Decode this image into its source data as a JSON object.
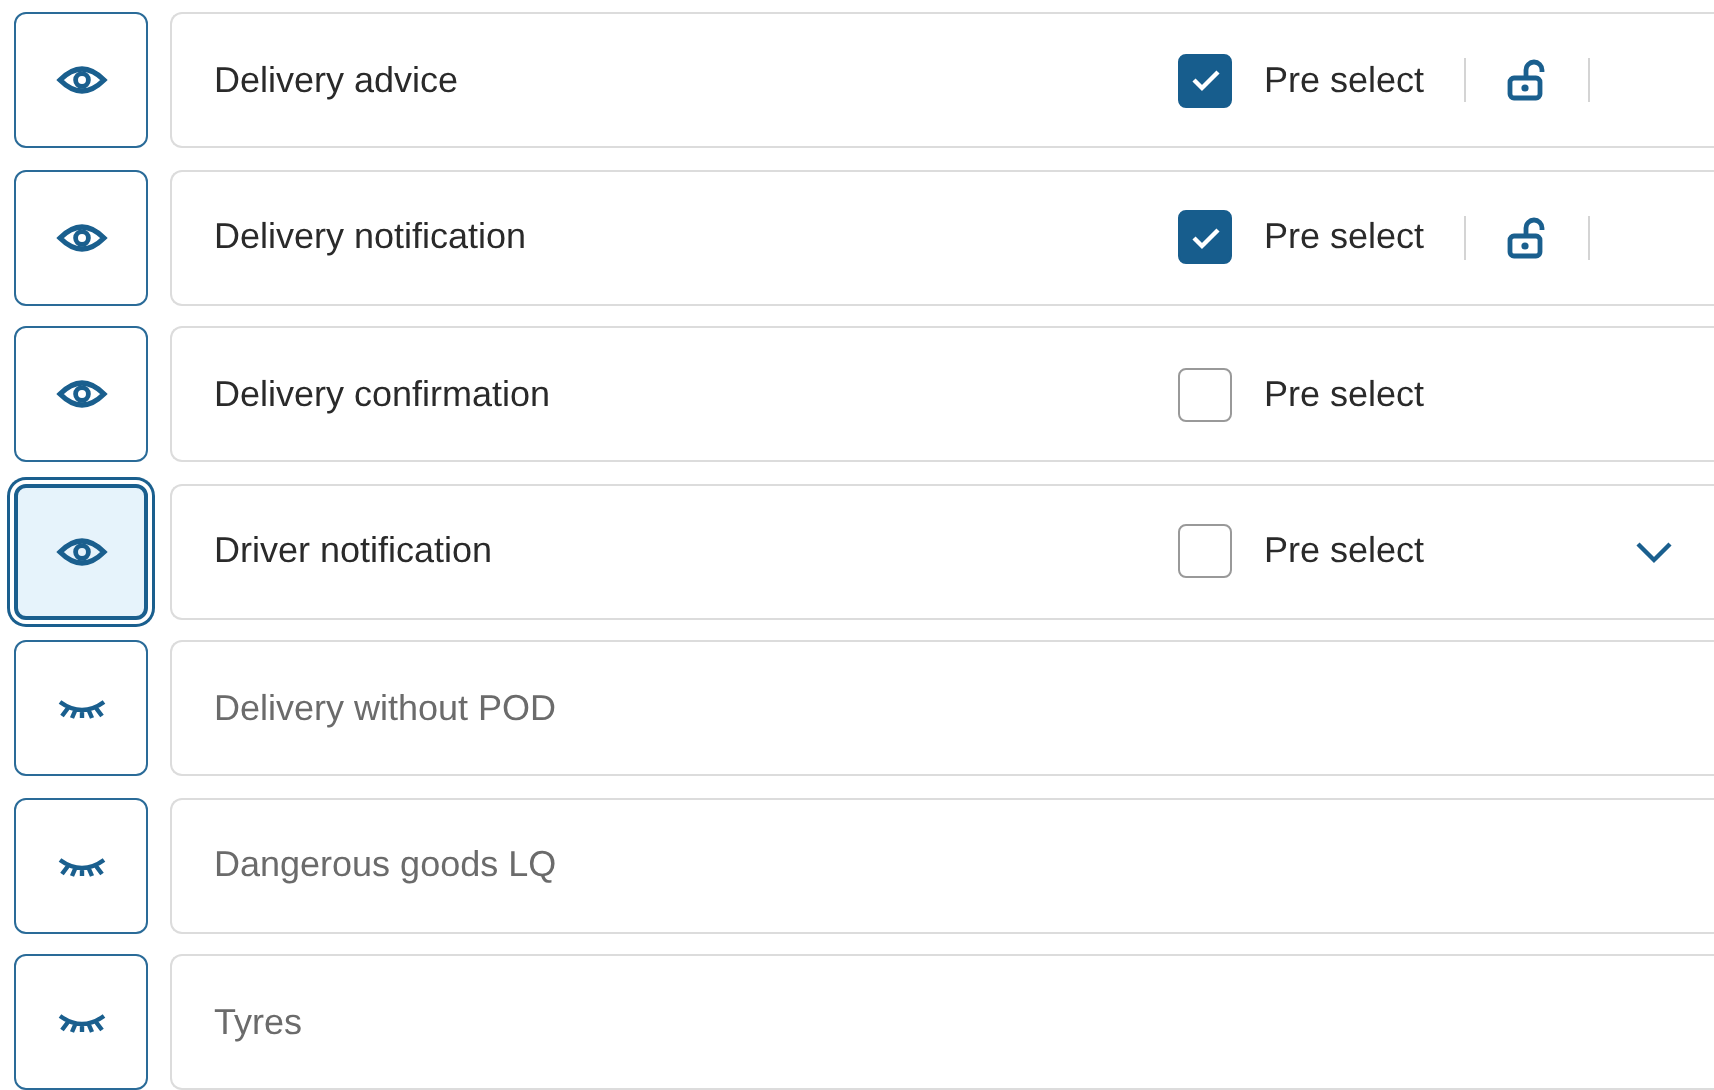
{
  "rows": [
    {
      "label": "Delivery advice",
      "visible": true,
      "focused": false,
      "pre_select": {
        "label": "Pre select",
        "checked": true
      },
      "locked": false
    },
    {
      "label": "Delivery notification",
      "visible": true,
      "focused": false,
      "pre_select": {
        "label": "Pre select",
        "checked": true
      },
      "locked": false
    },
    {
      "label": "Delivery confirmation",
      "visible": true,
      "focused": false,
      "pre_select": {
        "label": "Pre select",
        "checked": false
      }
    },
    {
      "label": "Driver notification",
      "visible": true,
      "focused": true,
      "pre_select": {
        "label": "Pre select",
        "checked": false
      },
      "expanded": false
    },
    {
      "label": "Delivery without POD",
      "visible": false,
      "focused": false
    },
    {
      "label": "Dangerous goods LQ",
      "visible": false,
      "focused": false
    },
    {
      "label": "Tyres",
      "visible": false,
      "focused": false
    }
  ]
}
